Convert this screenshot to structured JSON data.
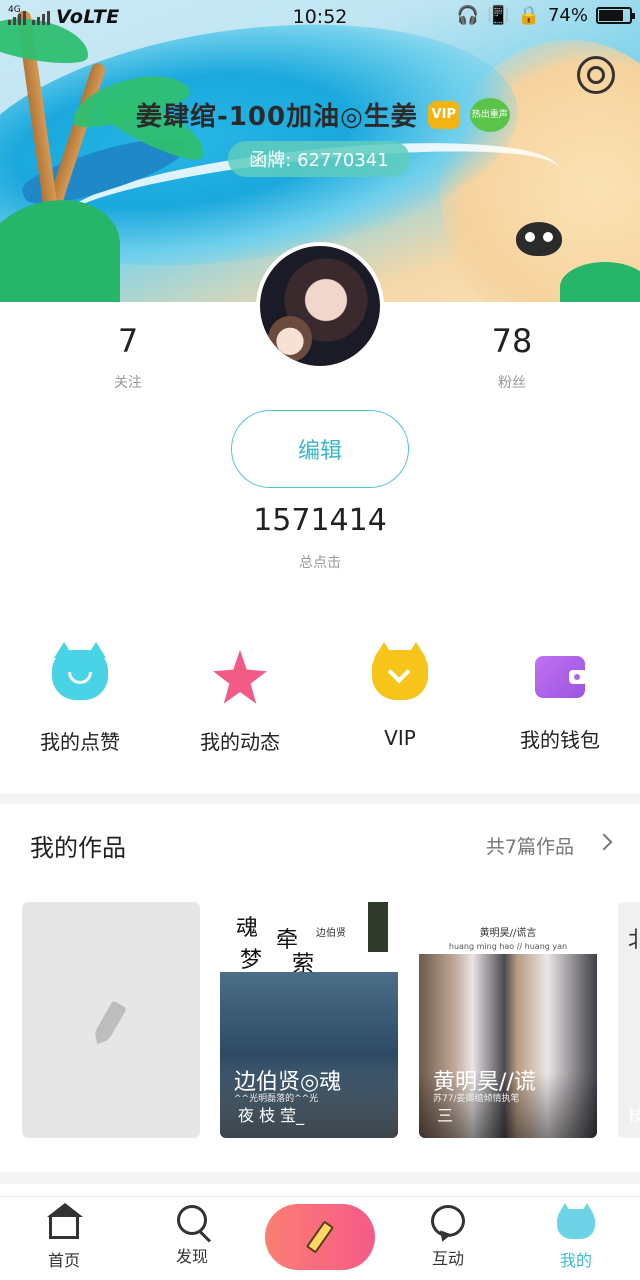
{
  "status_bar": {
    "network": "4G",
    "carrier": "VoLTE",
    "time": "10:52",
    "battery": "74%",
    "battery_level": 0.74
  },
  "profile": {
    "nickname": "姜肆绾-100加油◎生姜",
    "vip_badge": "VIP",
    "green_badge": "热出重声",
    "id_text": "函牌: 62770341",
    "following_count": "7",
    "following_label": "关注",
    "followers_count": "78",
    "followers_label": "粉丝",
    "edit_label": "编辑",
    "total_clicks": "1571414",
    "total_clicks_label": "总点击"
  },
  "quick_actions": [
    {
      "label": "我的点赞",
      "icon": "cat-like-icon",
      "color": "#48d3e6"
    },
    {
      "label": "我的动态",
      "icon": "star-icon",
      "color": "#f25b86"
    },
    {
      "label": "VIP",
      "icon": "vip-icon",
      "color": "#f7c51a"
    },
    {
      "label": "我的钱包",
      "icon": "wallet-icon",
      "color": "#b065ea"
    }
  ],
  "works": {
    "title": "我的作品",
    "count_text": "共7篇作品",
    "cards": [
      {
        "type": "new",
        "icon": "pencil-icon"
      },
      {
        "calli_1": "魂",
        "calli_2": "牵",
        "calli_3": "梦",
        "calli_4": "萦",
        "caption": "边伯贤",
        "title": "边伯贤◎魂",
        "subtitle": "夜 枝 莹_",
        "small": "^^光明磊落的^^光"
      },
      {
        "header": "黄明昊//谎言",
        "sub": "huang ming hao // huang yan",
        "title": "黄明昊//谎",
        "small": "苏77/姜卿绾倾情执笔",
        "subtitle": "三"
      },
      {
        "title": "北",
        "subtitle": "枝"
      }
    ]
  },
  "bottom_nav": [
    {
      "label": "首页",
      "icon": "home-icon"
    },
    {
      "label": "发现",
      "icon": "search-icon"
    },
    {
      "label": "",
      "icon": "pencil-create-icon"
    },
    {
      "label": "互动",
      "icon": "chat-icon"
    },
    {
      "label": "我的",
      "icon": "mine-cat-icon",
      "active": true
    }
  ],
  "colors": {
    "accent": "#3bbdd2",
    "create_button": "#f65a88"
  }
}
